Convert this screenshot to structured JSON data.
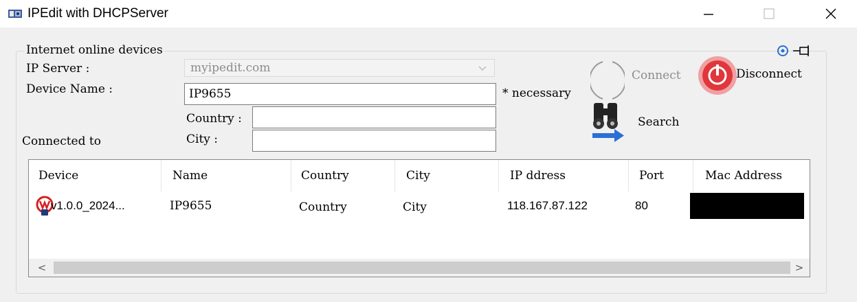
{
  "window": {
    "title": "IPEdit with DHCPServer",
    "controls": {
      "minimize": "—",
      "maximize": "☐",
      "close": "✕"
    }
  },
  "group": {
    "title": "Internet online devices",
    "ip_server_label": "IP Server :",
    "ip_server_value": "myipedit.com",
    "device_name_label": "Device Name :",
    "device_name_value": "IP9655",
    "necessary_note": "* necessary",
    "country_label": "Country :",
    "country_value": "",
    "city_label": "City :",
    "city_value": "",
    "connected_to_label": "Connected to"
  },
  "buttons": {
    "connect_label": "Connect",
    "disconnect_label": "Disconnect",
    "search_label": "Search"
  },
  "table": {
    "columns": [
      "Device",
      "Name",
      "Country",
      "City",
      "IP ddress",
      "Port",
      "Mac Address"
    ],
    "rows": [
      {
        "device": "v1.0.0_2024...",
        "name": "IP9655",
        "country": "Country",
        "city": "City",
        "ip": "118.167.87.122",
        "port": "80",
        "mac": ""
      }
    ]
  },
  "scrollbar": {
    "left_arrow": "<",
    "right_arrow": ">"
  },
  "colors": {
    "disconnect_red": "#e0373c",
    "search_arrow_blue": "#2a6fd6",
    "border": "#828790"
  }
}
